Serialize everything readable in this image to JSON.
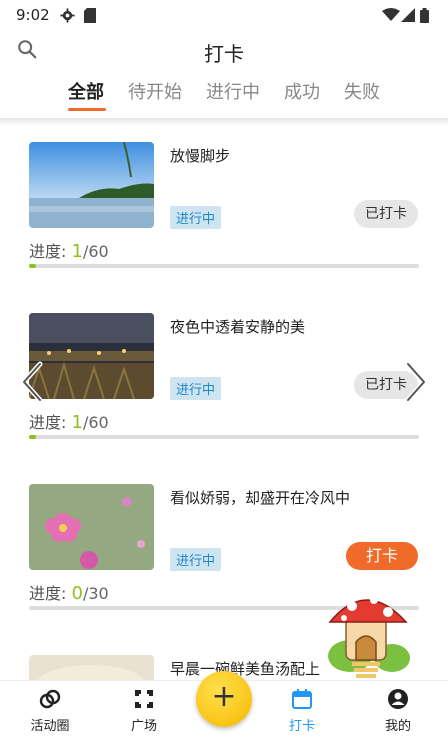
{
  "status_bar": {
    "time": "9:02"
  },
  "header": {
    "title": "打卡"
  },
  "tabs": [
    {
      "label": "全部",
      "active": true
    },
    {
      "label": "待开始",
      "active": false
    },
    {
      "label": "进行中",
      "active": false
    },
    {
      "label": "成功",
      "active": false
    },
    {
      "label": "失败",
      "active": false
    }
  ],
  "cards": [
    {
      "title": "放慢脚步",
      "status": "进行中",
      "action": "已打卡",
      "progress_label": "进度:",
      "progress_value": "1",
      "progress_total": "/60",
      "progress": 0.0167
    },
    {
      "title": "夜色中透着安静的美",
      "status": "进行中",
      "action": "已打卡",
      "progress_label": "进度:",
      "progress_value": "1",
      "progress_total": "/60",
      "progress": 0.0167
    },
    {
      "title": "看似娇弱，却盛开在冷风中",
      "status": "进行中",
      "action": "打卡",
      "progress_label": "进度:",
      "progress_value": "0",
      "progress_total": "/30",
      "progress": 0
    },
    {
      "title": "早晨一碗鲜美鱼汤配上"
    }
  ],
  "tabbar": {
    "items": [
      {
        "label": "活动圈",
        "icon": "circles-icon"
      },
      {
        "label": "广场",
        "icon": "square-frame-icon"
      },
      {
        "label": "打卡",
        "icon": "calendar-icon",
        "active": true
      },
      {
        "label": "我的",
        "icon": "person-icon"
      }
    ],
    "fab_label": "+"
  },
  "colors": {
    "accent": "#f06b2a",
    "active_tab": "#2196f3",
    "progress": "#8dc21f",
    "badge_bg": "#cfe4f1",
    "badge_text": "#1e88c5"
  }
}
